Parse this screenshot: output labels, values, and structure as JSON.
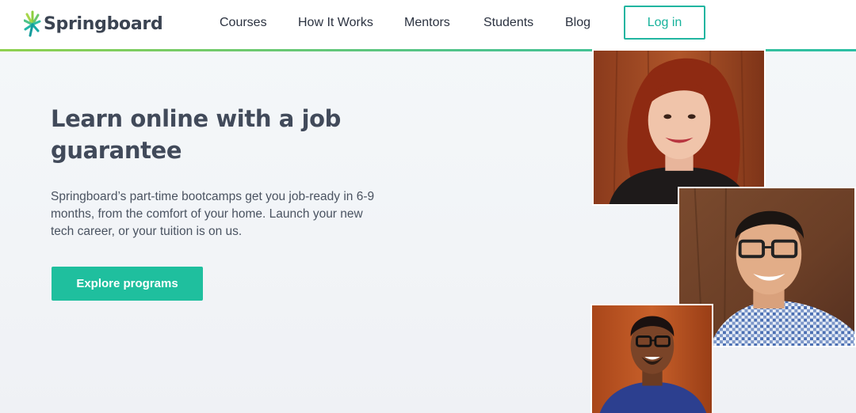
{
  "header": {
    "logo_text": "Springboard",
    "nav": [
      {
        "label": "Courses"
      },
      {
        "label": "How It Works"
      },
      {
        "label": "Mentors"
      },
      {
        "label": "Students"
      },
      {
        "label": "Blog"
      }
    ],
    "login_label": "Log in"
  },
  "hero": {
    "headline": "Learn online with a job guarantee",
    "subtext": "Springboard’s part-time bootcamps get you job-ready in 6-9 months, from the comfort of your home. Launch your new tech career, or your tuition is on us.",
    "cta_label": "Explore programs"
  },
  "photos": [
    {
      "name": "mentor-photo-woman"
    },
    {
      "name": "mentor-photo-man-glasses"
    },
    {
      "name": "mentor-photo-man-beard"
    }
  ],
  "colors": {
    "brand_teal": "#1fbf9e",
    "brand_green": "#8fd14f",
    "text_dark": "#414a5a"
  }
}
